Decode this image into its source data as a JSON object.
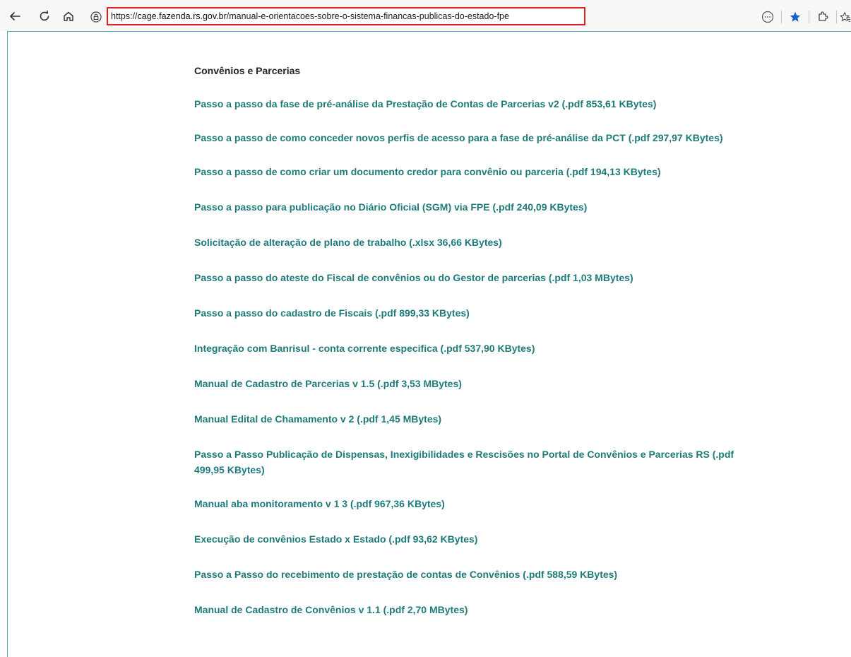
{
  "browser": {
    "url_prefix": "https://",
    "url_host": "cage.fazenda.rs.gov.br",
    "url_path": "/manual-e-orientacoes-sobre-o-sistema-financas-publicas-do-estado-fpe",
    "colors": {
      "highlight_border": "#e02020",
      "favorite_star": "#1a5fd0"
    },
    "icons": [
      "back-arrow-icon",
      "refresh-icon",
      "home-icon",
      "site-info-icon",
      "more-icon",
      "favorite-star-icon",
      "extensions-icon",
      "favorites-icon"
    ]
  },
  "page": {
    "section_title": "Convênios e Parcerias",
    "link_color": "#1f7a7a",
    "links": [
      {
        "label": "Passo a passo da fase de pré-análise da Prestação de Contas de Parcerias v2 (.pdf 853,61 KBytes)"
      },
      {
        "label": "Passo a passo de como conceder novos perfis de acesso para a fase de pré-análise da PCT (.pdf 297,97 KBytes)"
      },
      {
        "label": "Passo a passo de como criar um documento credor para convênio ou parceria (.pdf 194,13 KBytes)"
      },
      {
        "label": "Passo a passo para publicação no Diário Oficial (SGM) via FPE (.pdf 240,09 KBytes)"
      },
      {
        "label": "Solicitação de alteração de plano de trabalho (.xlsx 36,66 KBytes)"
      },
      {
        "label": "Passo a passo do ateste do Fiscal de convênios ou do Gestor de parcerias (.pdf 1,03 MBytes)"
      },
      {
        "label": "Passo a passo do cadastro de Fiscais (.pdf 899,33 KBytes)"
      },
      {
        "label": "Integração com Banrisul - conta corrente especifica (.pdf 537,90 KBytes)"
      },
      {
        "label": "Manual de Cadastro de Parcerias v 1.5 (.pdf 3,53 MBytes)"
      },
      {
        "label": "Manual Edital de Chamamento v 2 (.pdf 1,45 MBytes)"
      },
      {
        "label": "Passo a Passo Publicação de Dispensas, Inexigibilidades e Rescisões no Portal de Convênios e Parcerias RS (.pdf 499,95 KBytes)"
      },
      {
        "label": "Manual aba monitoramento v 1 3 (.pdf 967,36 KBytes)"
      },
      {
        "label": "Execução de convênios Estado x Estado (.pdf 93,62 KBytes)"
      },
      {
        "label": "Passo a Passo do recebimento de prestação de contas de Convênios (.pdf 588,59 KBytes)"
      },
      {
        "label": "Manual de Cadastro de Convênios v 1.1 (.pdf 2,70 MBytes)"
      }
    ]
  }
}
